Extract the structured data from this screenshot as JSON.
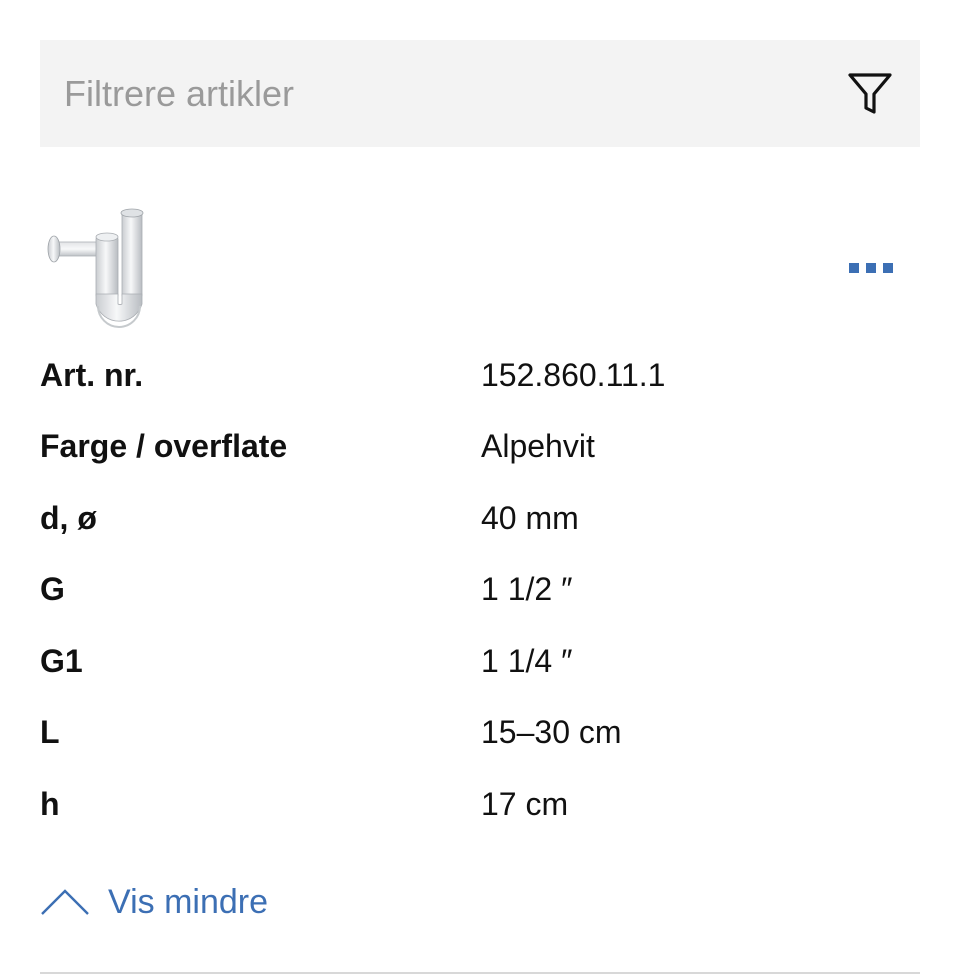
{
  "filter": {
    "placeholder": "Filtrere artikler",
    "value": "",
    "icon": "filter-funnel-icon"
  },
  "product": {
    "image_icon": "siphon-product-image",
    "more_icon": "more-options-icon",
    "accent_color": "#3c6fb4"
  },
  "specs": [
    {
      "label": "Art. nr.",
      "value": "152.860.11.1"
    },
    {
      "label": "Farge / overflate",
      "value": "Alpehvit"
    },
    {
      "label": "d, ø",
      "value": "40 mm"
    },
    {
      "label": "G",
      "value": "1 1/2 ″"
    },
    {
      "label": "G1",
      "value": "1 1/4 ″"
    },
    {
      "label": "L",
      "value": "15–30 cm"
    },
    {
      "label": "h",
      "value": "17 cm"
    }
  ],
  "toggle": {
    "label": "Vis mindre",
    "icon": "chevron-up-icon"
  }
}
